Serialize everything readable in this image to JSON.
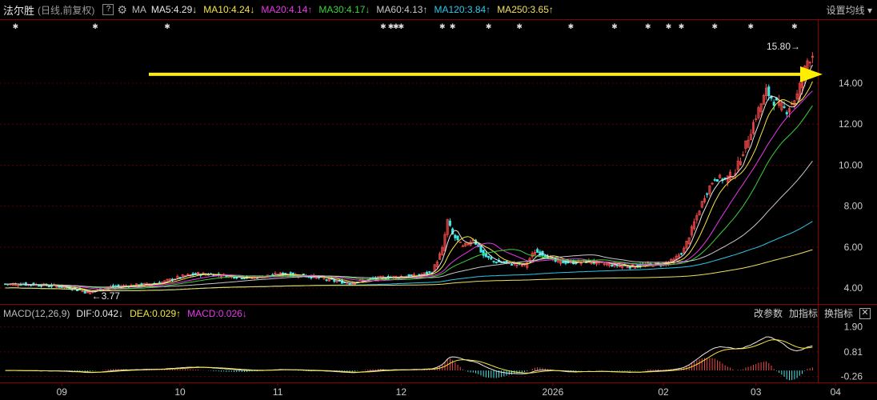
{
  "header": {
    "stock_name": "法尔胜",
    "sub": "(日线,前复权)",
    "question": "?",
    "ma_label": "MA",
    "ma_items": [
      {
        "text": "MA5:4.29",
        "arrow": "↓",
        "color": "#e6e6e6"
      },
      {
        "text": "MA10:4.24",
        "arrow": "↓",
        "color": "#f5e642"
      },
      {
        "text": "MA20:4.14",
        "arrow": "↑",
        "color": "#e838e8"
      },
      {
        "text": "MA30:4.17",
        "arrow": "↓",
        "color": "#3ad23a"
      },
      {
        "text": "MA60:4.13",
        "arrow": "↑",
        "color": "#c8c8c8"
      },
      {
        "text": "MA120:3.84",
        "arrow": "↑",
        "color": "#2ec8e8"
      },
      {
        "text": "MA250:3.65",
        "arrow": "↑",
        "color": "#f0e060"
      }
    ],
    "settings_label": "设置均线",
    "settings_caret": "▾"
  },
  "macd": {
    "label": "MACD(12,26,9)",
    "dif": "DIF:0.042",
    "dif_arrow": "↓",
    "dea": "DEA:0.029",
    "dea_arrow": "↑",
    "macd": "MACD:0.026",
    "macd_arrow": "↓",
    "tools": [
      "改参数",
      "加指标",
      "换指标"
    ],
    "close": "✕"
  },
  "colors": {
    "up": "#f04848",
    "down": "#40e8e8",
    "arrow": "#ffee00",
    "dif": "#e6e6e6",
    "dea": "#f5e642",
    "hist_up": "#f04848",
    "hist_down": "#40e8e8",
    "axis": "#8a0000"
  },
  "annotations": {
    "high": "15.80",
    "high_arrow": "→",
    "low": "3.77",
    "low_arrow": "←"
  },
  "chart_data": [
    {
      "type": "candlestick",
      "title": "法尔胜 (日线,前复权)",
      "x_ticks": [
        "09",
        "10",
        "11",
        "12",
        "2026",
        "02",
        "03",
        "04"
      ],
      "y_ticks": [
        4.0,
        6.0,
        8.0,
        10.0,
        12.0,
        14.0
      ],
      "y_tick_labels": [
        "4.00",
        "6.00",
        "8.00",
        "10.00",
        "12.00",
        "14.00"
      ],
      "ylim": [
        3.3,
        16.5
      ],
      "high_marker": 15.8,
      "low_marker": 3.77,
      "price_path": [
        [
          0,
          4.2
        ],
        [
          10,
          4.18
        ],
        [
          20,
          4.1
        ],
        [
          28,
          3.95
        ],
        [
          32,
          3.77
        ],
        [
          40,
          4.05
        ],
        [
          52,
          4.15
        ],
        [
          60,
          4.25
        ],
        [
          68,
          4.55
        ],
        [
          75,
          4.7
        ],
        [
          82,
          4.65
        ],
        [
          90,
          4.55
        ],
        [
          96,
          4.5
        ],
        [
          102,
          4.6
        ],
        [
          108,
          4.7
        ],
        [
          114,
          4.62
        ],
        [
          120,
          4.55
        ],
        [
          128,
          4.35
        ],
        [
          134,
          4.25
        ],
        [
          140,
          4.4
        ],
        [
          146,
          4.5
        ],
        [
          152,
          4.55
        ],
        [
          160,
          4.6
        ],
        [
          166,
          4.8
        ],
        [
          170,
          5.9
        ],
        [
          172,
          7.3
        ],
        [
          174,
          6.6
        ],
        [
          178,
          6.0
        ],
        [
          182,
          6.4
        ],
        [
          186,
          5.6
        ],
        [
          190,
          5.3
        ],
        [
          196,
          5.2
        ],
        [
          202,
          5.1
        ],
        [
          206,
          5.8
        ],
        [
          210,
          5.6
        ],
        [
          214,
          5.3
        ],
        [
          220,
          5.25
        ],
        [
          226,
          5.3
        ],
        [
          232,
          5.2
        ],
        [
          238,
          5.1
        ],
        [
          244,
          5.05
        ],
        [
          250,
          5.15
        ],
        [
          256,
          5.2
        ],
        [
          260,
          5.35
        ],
        [
          264,
          5.9
        ],
        [
          268,
          7.2
        ],
        [
          272,
          8.5
        ],
        [
          276,
          9.4
        ],
        [
          280,
          9.3
        ],
        [
          284,
          9.7
        ],
        [
          288,
          11.0
        ],
        [
          292,
          12.4
        ],
        [
          296,
          13.6
        ],
        [
          300,
          13.0
        ],
        [
          304,
          12.7
        ],
        [
          308,
          13.4
        ],
        [
          312,
          15.1
        ],
        [
          314,
          15.4
        ]
      ],
      "n_bars": 315,
      "ma_series": [
        {
          "name": "MA5",
          "period": 5,
          "color": "#e6e6e6"
        },
        {
          "name": "MA10",
          "period": 10,
          "color": "#f5e642"
        },
        {
          "name": "MA20",
          "period": 20,
          "color": "#e838e8"
        },
        {
          "name": "MA30",
          "period": 30,
          "color": "#3ad23a"
        },
        {
          "name": "MA60",
          "period": 60,
          "color": "#c8c8c8"
        },
        {
          "name": "MA120",
          "period": 120,
          "color": "#2ec8e8"
        },
        {
          "name": "MA250",
          "period": 250,
          "color": "#f0e060"
        }
      ],
      "arrow_level": 14.2
    },
    {
      "type": "macd",
      "y_ticks": [
        1.9,
        0.81,
        -0.26
      ],
      "y_tick_labels": [
        "1.90",
        "0.81",
        "-0.26"
      ],
      "ylim": [
        -0.45,
        2.2
      ]
    }
  ]
}
